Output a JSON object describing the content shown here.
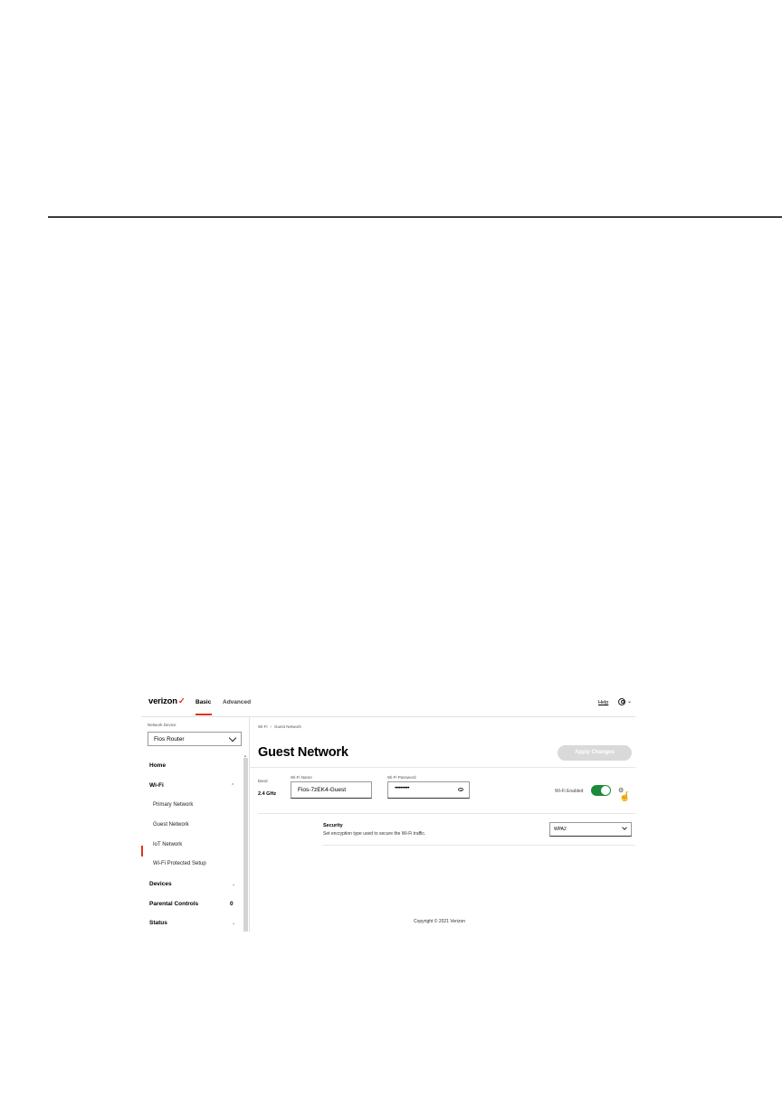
{
  "header": {
    "logo": "verizon",
    "logo_check": "✓",
    "nav": {
      "basic": "Basic",
      "advanced": "Advanced"
    },
    "help": "Help",
    "account_chevron": "⌄"
  },
  "sidebar": {
    "device_label": "Network Device",
    "device_value": "Fios Router",
    "items": [
      {
        "label": "Home"
      },
      {
        "label": "Wi-Fi",
        "arrow": "^"
      },
      {
        "label": "Primary Network"
      },
      {
        "label": "Guest Network"
      },
      {
        "label": "IoT Network"
      },
      {
        "label": "Wi-Fi Protected Setup"
      },
      {
        "label": "Devices",
        "arrow": "⌄"
      },
      {
        "label": "Parental Controls",
        "count": "0"
      },
      {
        "label": "Status",
        "arrow": "⌄"
      }
    ]
  },
  "main": {
    "breadcrumb": {
      "parent": "Wi-Fi",
      "sep": "›",
      "current": "Guest Network"
    },
    "title": "Guest Network",
    "apply_label": "Apply Changes",
    "band": {
      "label": "Band",
      "value": "2.4 GHz"
    },
    "wifi_name": {
      "label": "Wi-Fi Name",
      "value": "Fios-7zEK4-Guest"
    },
    "wifi_password": {
      "label": "Wi-Fi Password",
      "value": "••••••••••"
    },
    "wifi_enabled_label": "Wi-Fi Enabled",
    "wifi_enabled": true,
    "security": {
      "title": "Security",
      "description": "Set encryption type used to secure the Wi-Fi traffic.",
      "value": "WPA2"
    }
  },
  "footer": {
    "copyright": "Copyright © 2021 Verizon"
  },
  "colors": {
    "brand_red": "#e0321f",
    "toggle_green": "#1b8a3a",
    "button_disabled": "#d9d9d9"
  }
}
